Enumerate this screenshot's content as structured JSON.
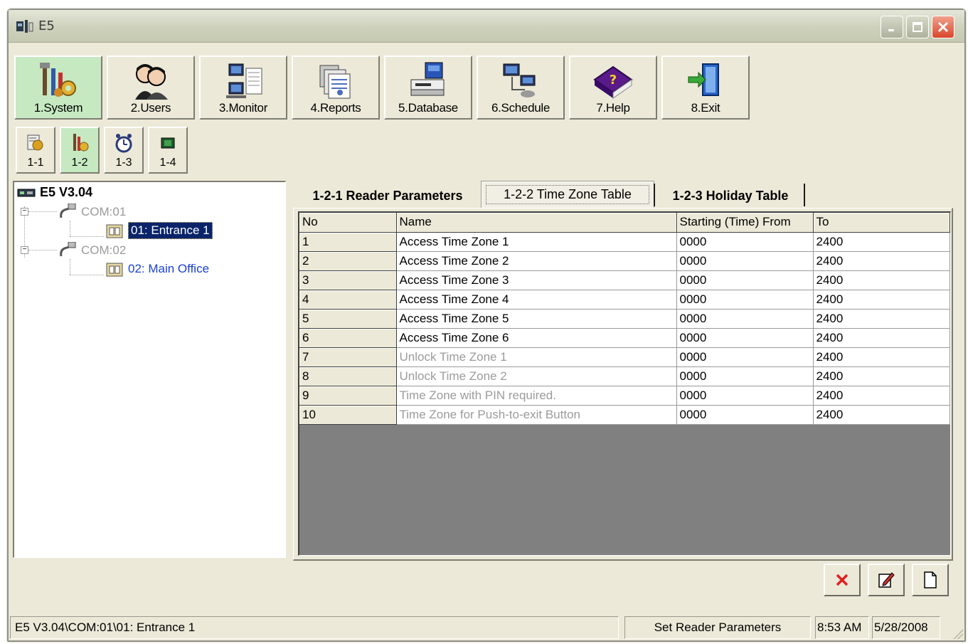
{
  "window": {
    "title": "E5"
  },
  "toolbar": [
    {
      "label": "1.System",
      "icon": "system-tools-icon",
      "active": true
    },
    {
      "label": "2.Users",
      "icon": "users-icon",
      "active": false
    },
    {
      "label": "3.Monitor",
      "icon": "monitor-icon",
      "active": false
    },
    {
      "label": "4.Reports",
      "icon": "reports-icon",
      "active": false
    },
    {
      "label": "5.Database",
      "icon": "database-icon",
      "active": false
    },
    {
      "label": "6.Schedule",
      "icon": "schedule-icon",
      "active": false
    },
    {
      "label": "7.Help",
      "icon": "help-book-icon",
      "active": false
    },
    {
      "label": "8.Exit",
      "icon": "exit-door-icon",
      "active": false
    }
  ],
  "subtoolbar": [
    {
      "label": "1-1",
      "icon": "settings-icon",
      "active": false
    },
    {
      "label": "1-2",
      "icon": "reader-params-icon",
      "active": true
    },
    {
      "label": "1-3",
      "icon": "clock-icon",
      "active": false
    },
    {
      "label": "1-4",
      "icon": "chip-icon",
      "active": false
    }
  ],
  "tree": {
    "root": "E5 V3.04",
    "ports": [
      {
        "label": "COM:01",
        "readers": [
          {
            "label": "01: Entrance 1",
            "selected": true
          }
        ]
      },
      {
        "label": "COM:02",
        "readers": [
          {
            "label": "02: Main Office",
            "selected": false
          }
        ]
      }
    ]
  },
  "tabs": [
    {
      "label": "1-2-1 Reader Parameters",
      "selected": false
    },
    {
      "label": "1-2-2 Time Zone Table",
      "selected": true
    },
    {
      "label": "1-2-3 Holiday Table",
      "selected": false
    }
  ],
  "table": {
    "columns": [
      "No",
      "Name",
      "Starting (Time) From",
      "To"
    ],
    "rows": [
      {
        "no": "1",
        "name": "Access Time Zone 1",
        "from": "0000",
        "to": "2400",
        "dim": false
      },
      {
        "no": "2",
        "name": "Access Time Zone 2",
        "from": "0000",
        "to": "2400",
        "dim": false
      },
      {
        "no": "3",
        "name": "Access Time Zone 3",
        "from": "0000",
        "to": "2400",
        "dim": false
      },
      {
        "no": "4",
        "name": "Access Time Zone 4",
        "from": "0000",
        "to": "2400",
        "dim": false
      },
      {
        "no": "5",
        "name": "Access Time Zone 5",
        "from": "0000",
        "to": "2400",
        "dim": false
      },
      {
        "no": "6",
        "name": "Access Time Zone 6",
        "from": "0000",
        "to": "2400",
        "dim": false
      },
      {
        "no": "7",
        "name": "Unlock Time Zone 1",
        "from": "0000",
        "to": "2400",
        "dim": true
      },
      {
        "no": "8",
        "name": "Unlock Time Zone 2",
        "from": "0000",
        "to": "2400",
        "dim": true
      },
      {
        "no": "9",
        "name": "Time Zone with PIN required.",
        "from": "0000",
        "to": "2400",
        "dim": true
      },
      {
        "no": "10",
        "name": "Time Zone for Push-to-exit Button",
        "from": "0000",
        "to": "2400",
        "dim": true
      }
    ]
  },
  "actions": [
    {
      "name": "delete-button",
      "icon": "red-x-icon"
    },
    {
      "name": "edit-button",
      "icon": "edit-pencil-icon"
    },
    {
      "name": "new-button",
      "icon": "new-document-icon"
    }
  ],
  "status": {
    "path": "E5 V3.04\\COM:01\\01: Entrance 1",
    "message": "Set Reader Parameters",
    "time": "8:53 AM",
    "date": "5/28/2008"
  },
  "colors": {
    "active_button": "#c6e9c2",
    "selection": "#0a246a",
    "reader_link": "#1a3fd6",
    "grid_empty": "#808080"
  }
}
